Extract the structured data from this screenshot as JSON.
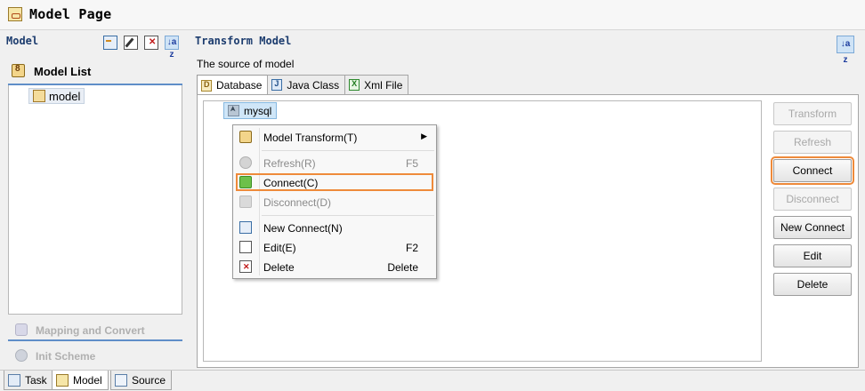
{
  "window": {
    "title": "Model Page",
    "icon": "model-page-icon"
  },
  "left_panel": {
    "title": "Model",
    "toolbar": [
      {
        "name": "new-connect-icon"
      },
      {
        "name": "edit-icon"
      },
      {
        "name": "delete-icon"
      },
      {
        "name": "sort-az-icon",
        "label": "↓a z",
        "pressed": true
      }
    ],
    "section_label": "Model List",
    "items": [
      {
        "label": "model"
      }
    ],
    "mapping_label": "Mapping and Convert",
    "init_label": "Init Scheme"
  },
  "right_panel": {
    "title": "Transform Model",
    "sort_label": "↓a z",
    "source_label": "The source of model",
    "tabs": [
      {
        "label": "Database",
        "active": true
      },
      {
        "label": "Java Class",
        "active": false
      },
      {
        "label": "Xml File",
        "active": false
      }
    ],
    "tree_node": "mysql",
    "buttons": {
      "transform": "Transform",
      "refresh": "Refresh",
      "connect": "Connect",
      "disconnect": "Disconnect",
      "new_connect": "New Connect",
      "edit": "Edit",
      "delete": "Delete"
    }
  },
  "context_menu": {
    "items": [
      {
        "label": "Model Transform(T)",
        "shortcut": "",
        "submenu": true,
        "enabled": true
      },
      {
        "label": "Refresh(R)",
        "shortcut": "F5",
        "enabled": false
      },
      {
        "label": "Connect(C)",
        "shortcut": "",
        "enabled": true,
        "highlighted": true
      },
      {
        "label": "Disconnect(D)",
        "shortcut": "",
        "enabled": false
      },
      {
        "label": "New Connect(N)",
        "shortcut": "",
        "enabled": true
      },
      {
        "label": "Edit(E)",
        "shortcut": "F2",
        "enabled": true
      },
      {
        "label": "Delete",
        "shortcut": "Delete",
        "enabled": true
      }
    ]
  },
  "bottom_tabs": [
    {
      "label": "Task",
      "active": false
    },
    {
      "label": "Model",
      "active": true
    },
    {
      "label": "Source",
      "active": false
    }
  ],
  "colors": {
    "highlight": "#ee8a3a",
    "accent_blue": "#5f8ec8",
    "header_text": "#1c3c6e"
  }
}
